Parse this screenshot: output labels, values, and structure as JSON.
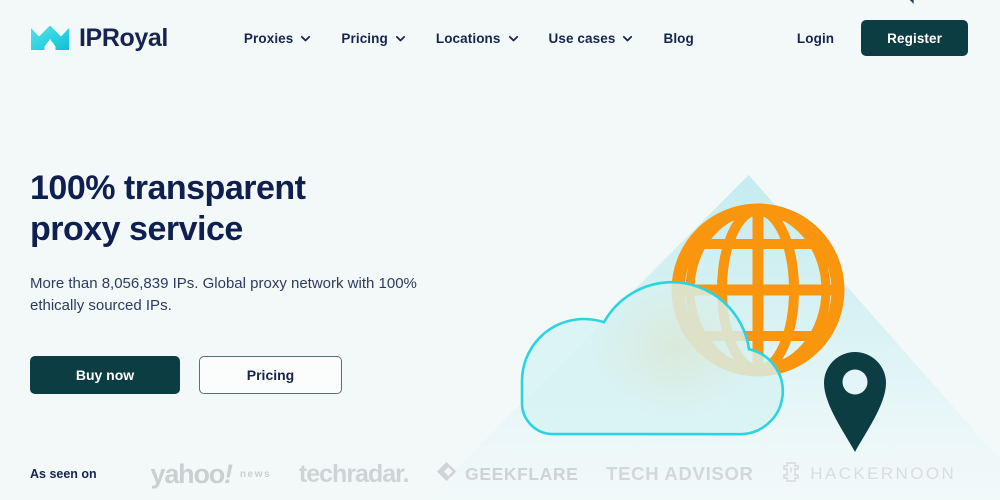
{
  "brand": {
    "name": "IPRoyal",
    "logo_icon": "crown-mountain-icon",
    "logo_colors": [
      "#2bd4e0",
      "#5ce1ea",
      "#12b6cc"
    ]
  },
  "header": {
    "nav": [
      {
        "label": "Proxies",
        "has_dropdown": true,
        "icon": "chevron-down-icon"
      },
      {
        "label": "Pricing",
        "has_dropdown": true,
        "icon": "chevron-down-icon"
      },
      {
        "label": "Locations",
        "has_dropdown": true,
        "icon": "chevron-down-icon"
      },
      {
        "label": "Use cases",
        "has_dropdown": true,
        "icon": "chevron-down-icon"
      },
      {
        "label": "Blog",
        "has_dropdown": false,
        "icon": ""
      }
    ],
    "login_label": "Login",
    "register_label": "Register",
    "register_bg": "#0c3d43"
  },
  "hero": {
    "title": "100% transparent proxy service",
    "subtitle": "More than 8,056,839 IPs. Global proxy network with 100% ethically sourced IPs.",
    "ip_count": "8,056,839",
    "primary_cta": "Buy now",
    "secondary_cta": "Pricing",
    "illustration": {
      "globe_icon": "globe-icon",
      "cloud_icon": "cloud-icon",
      "pin_icon": "map-pin-icon",
      "globe_color": "#f9960e",
      "cloud_fill": "#d6f2f3",
      "cloud_stroke": "#2bd4e0",
      "pin_color": "#0c3d43",
      "triangle_color": "#c5ecf0"
    }
  },
  "logo_bar": {
    "label": "As seen on",
    "logos": [
      {
        "name": "yahoo-news-logo",
        "text": "yahoo",
        "bang": "!",
        "sub": "news"
      },
      {
        "name": "techradar-logo",
        "text": "techradar."
      },
      {
        "name": "geekflare-logo",
        "text": "GEEKFLARE",
        "icon": "geekflare-chevron-icon"
      },
      {
        "name": "techadvisor-logo",
        "text": "TECH ADVISOR"
      },
      {
        "name": "hackernoon-logo",
        "text": "HACKERNOON",
        "icon": "hackernoon-bracket-icon"
      }
    ]
  },
  "colors": {
    "page_bg": "#f3f9f9",
    "text_dark": "#17254e",
    "accent_teal": "#0c3d43",
    "accent_cyan": "#2bd4e0",
    "accent_orange": "#f9960e"
  }
}
